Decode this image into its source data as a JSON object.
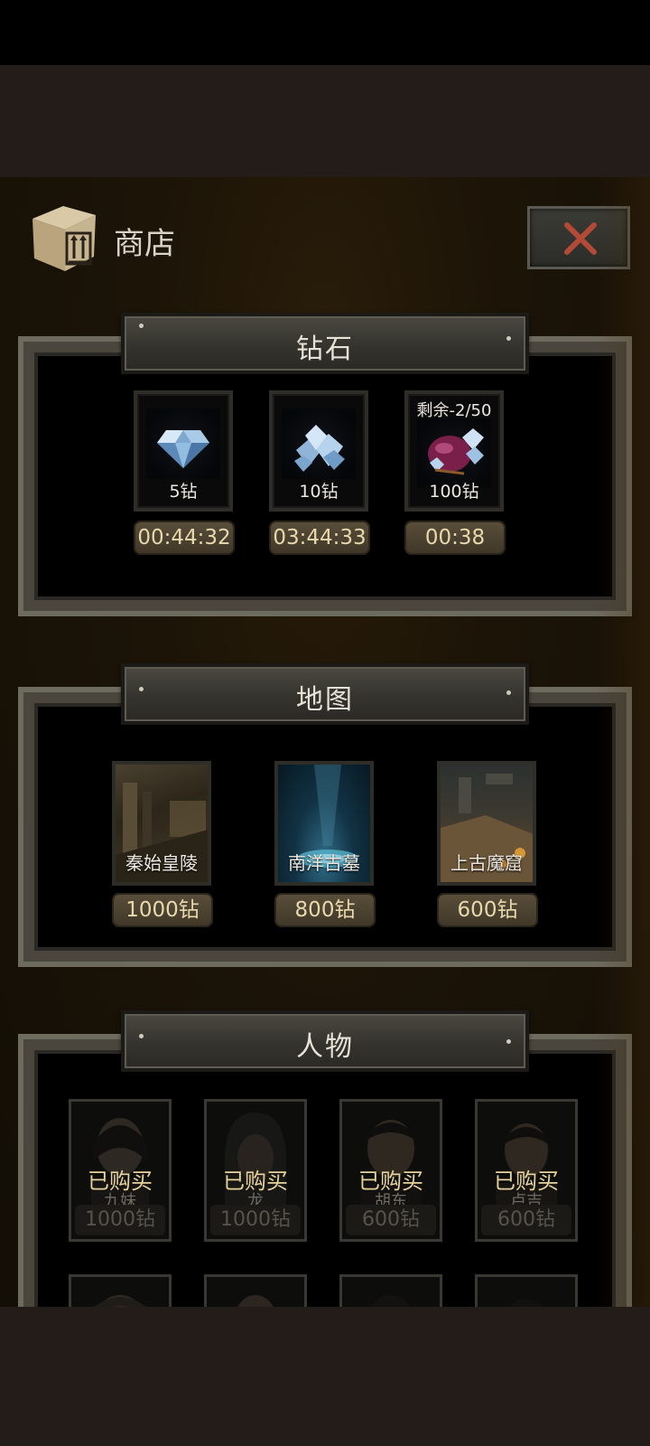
{
  "shop": {
    "title": "商店",
    "icons": {
      "shop": "box-icon",
      "close": "close-x-icon"
    },
    "colors": {
      "close_x": "#b24a36",
      "price_text": "#e8d9ac",
      "bought_text": "#e6d29c"
    }
  },
  "diamond_section": {
    "title": "钻石",
    "items": [
      {
        "label": "5钻",
        "timer": "00:44:32",
        "remaining": "",
        "icon": "diamond-single-icon"
      },
      {
        "label": "10钻",
        "timer": "03:44:33",
        "remaining": "",
        "icon": "diamond-pile-icon"
      },
      {
        "label": "100钻",
        "timer": "00:38",
        "remaining": "剩余-2/50",
        "icon": "diamond-bag-icon"
      }
    ]
  },
  "map_section": {
    "title": "地图",
    "items": [
      {
        "name": "秦始皇陵",
        "price": "1000钻"
      },
      {
        "name": "南洋古墓",
        "price": "800钻"
      },
      {
        "name": "上古魔窟",
        "price": "600钻"
      }
    ]
  },
  "character_section": {
    "title": "人物",
    "items": [
      {
        "status": "已购买",
        "name": "九妹",
        "price": "1000钻"
      },
      {
        "status": "已购买",
        "name": "龙",
        "price": "1000钻"
      },
      {
        "status": "已购买",
        "name": "胡东",
        "price": "600钻"
      },
      {
        "status": "已购买",
        "name": "卢吉",
        "price": "600钻"
      }
    ]
  }
}
